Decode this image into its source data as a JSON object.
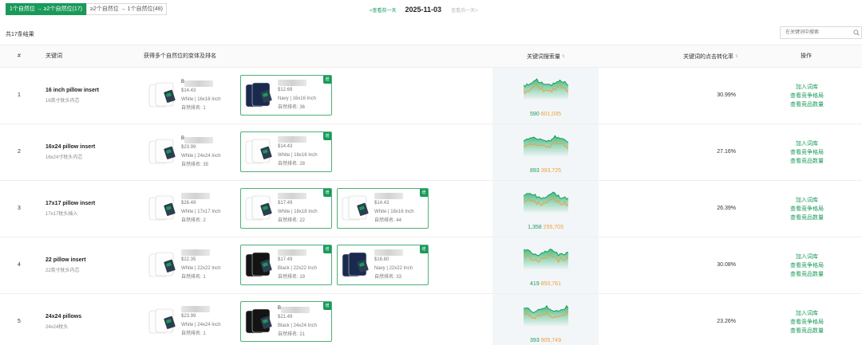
{
  "tabs": [
    {
      "label": "1个自然位 → ≥2个自然位(17)",
      "active": true
    },
    {
      "label": "≥2个自然位 → 1个自然位(48)",
      "active": false
    }
  ],
  "datenav": {
    "prev": "<查看前一天",
    "date": "2025-11-03",
    "next": "查看后一天>"
  },
  "result_count": "共17条结果",
  "search": {
    "placeholder": "在关键词中搜索"
  },
  "headers": {
    "index": "#",
    "keyword": "关键词",
    "variants": "获得多个自然位的变体及排名",
    "search_volume": "关键词搜索量",
    "ctr": "关键词的点击转化率",
    "ops": "操作"
  },
  "ops_labels": [
    "加入词库",
    "查看竞争格局",
    "查看竞品数量"
  ],
  "rank_label": "自然排名",
  "badge_label": "增",
  "colors": {
    "accent": "#1a9a5a",
    "orange": "#ef9e3c",
    "box": "#4cb07a",
    "navy": "#1a2a4f",
    "black": "#141414"
  },
  "rows": [
    {
      "index": "1",
      "keyword": "16 inch pillow insert",
      "keyword_cn": "16英寸枕头内芯",
      "volume_green": "590",
      "volume_orange": "601,035",
      "ctr": "30.99%",
      "variants": [
        {
          "name_initial": "B",
          "price": "$14.43",
          "spec": "White | 16x16 Inch",
          "rank": "1",
          "color": "white",
          "boxed": false
        },
        {
          "name_initial": "",
          "price": "$12.69",
          "spec": "Navy | 16x16 Inch",
          "rank": "36",
          "color": "navy",
          "boxed": true
        }
      ]
    },
    {
      "index": "2",
      "keyword": "16x24 pillow insert",
      "keyword_cn": "16x24寸枕头内芯",
      "volume_green": "893",
      "volume_orange": "393,725",
      "ctr": "27.16%",
      "variants": [
        {
          "name_initial": "B",
          "price": "$23.99",
          "spec": "White | 24x24 Inch",
          "rank": "35",
          "color": "white",
          "boxed": false
        },
        {
          "name_initial": "",
          "price": "$14.43",
          "spec": "White | 16x16 Inch",
          "rank": "28",
          "color": "white",
          "boxed": true
        }
      ]
    },
    {
      "index": "3",
      "keyword": "17x17 pillow insert",
      "keyword_cn": "17x17枕头插入",
      "volume_green": "1,358",
      "volume_orange": "255,703",
      "ctr": "26.39%",
      "variants": [
        {
          "name_initial": "",
          "price": "$26.49",
          "spec": "White | 17x17 Inch",
          "rank": "2",
          "color": "white",
          "boxed": false
        },
        {
          "name_initial": "",
          "price": "$17.49",
          "spec": "White | 18x18 Inch",
          "rank": "22",
          "color": "white",
          "boxed": true
        },
        {
          "name_initial": "",
          "price": "$14.43",
          "spec": "White | 16x16 Inch",
          "rank": "44",
          "color": "white",
          "boxed": true
        }
      ]
    },
    {
      "index": "4",
      "keyword": "22 pillow insert",
      "keyword_cn": "22英寸枕头内芯",
      "volume_green": "419",
      "volume_orange": "850,761",
      "ctr": "30.08%",
      "variants": [
        {
          "name_initial": "",
          "price": "$22.35",
          "spec": "White | 22x22 Inch",
          "rank": "1",
          "color": "white",
          "boxed": false
        },
        {
          "name_initial": "",
          "price": "$17.49",
          "spec": "Black | 22x22 Inch",
          "rank": "19",
          "color": "black",
          "boxed": true
        },
        {
          "name_initial": "",
          "price": "$16.80",
          "spec": "Navy | 22x22 Inch",
          "rank": "33",
          "color": "navy",
          "boxed": true
        }
      ]
    },
    {
      "index": "5",
      "keyword": "24x24 pillows",
      "keyword_cn": "24x24枕头",
      "volume_green": "393",
      "volume_orange": "905,749",
      "ctr": "23.26%",
      "variants": [
        {
          "name_initial": "",
          "price": "$23.99",
          "spec": "White | 24x24 Inch",
          "rank": "1",
          "color": "white",
          "boxed": false
        },
        {
          "name_initial": "B",
          "price": "$21.49",
          "spec": "Black | 24x24 Inch",
          "rank": "21",
          "color": "black",
          "boxed": true
        }
      ]
    }
  ]
}
